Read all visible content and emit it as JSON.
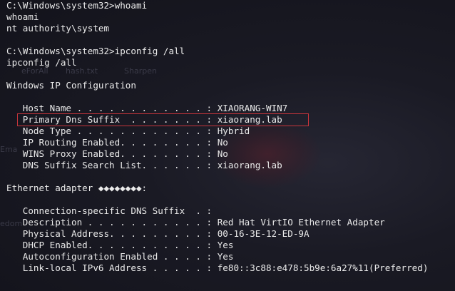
{
  "background_labels": {
    "left_fragment_a": "eForAll",
    "left_fragment_b": "Ema",
    "left_fragment_c": "edom",
    "mid_fragment_a": "hash.txt",
    "mid_fragment_b": "Sharpen"
  },
  "terminal": {
    "lines": [
      "C:\\Windows\\system32>whoami",
      "whoami",
      "nt authority\\system",
      "",
      "C:\\Windows\\system32>ipconfig /all",
      "ipconfig /all",
      "",
      "Windows IP Configuration",
      "",
      "   Host Name . . . . . . . . . . . . : XIAORANG-WIN7",
      "   Primary Dns Suffix  . . . . . . . : xiaorang.lab",
      "   Node Type . . . . . . . . . . . . : Hybrid",
      "   IP Routing Enabled. . . . . . . . : No",
      "   WINS Proxy Enabled. . . . . . . . : No",
      "   DNS Suffix Search List. . . . . . : xiaorang.lab",
      "",
      "Ethernet adapter ◆◆◆◆◆◆◆◆:",
      "",
      "   Connection-specific DNS Suffix  . :",
      "   Description . . . . . . . . . . . : Red Hat VirtIO Ethernet Adapter",
      "   Physical Address. . . . . . . . . : 00-16-3E-12-ED-9A",
      "   DHCP Enabled. . . . . . . . . . . : Yes",
      "   Autoconfiguration Enabled . . . . : Yes",
      "   Link-local IPv6 Address . . . . . : fe80::3c88:e478:5b9e:6a27%11(Preferred)"
    ]
  },
  "colors": {
    "text": "#eaeaea",
    "highlight": "#c8353b",
    "background": "#1a1a24"
  }
}
